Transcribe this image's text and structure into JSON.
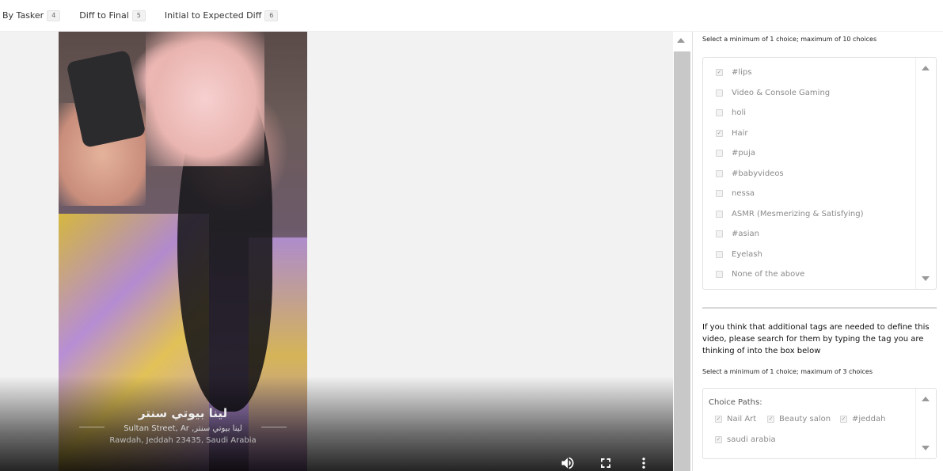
{
  "tabs": [
    {
      "label": "By Tasker",
      "count": "4"
    },
    {
      "label": "Diff to Final",
      "count": "5"
    },
    {
      "label": "Initial to Expected Diff",
      "count": "6"
    }
  ],
  "video": {
    "location_arabic": "لينا بيوتي سنتر",
    "location_street": "Sultan Street, Ar ,لينا بيوتي سنتر",
    "location_city": "Rawdah, Jeddah 23435, Saudi Arabia",
    "controls": {
      "volume_icon": "volume-icon",
      "fullscreen_icon": "fullscreen-icon",
      "more_icon": "more-vertical-icon"
    }
  },
  "panel": {
    "choices_hint": "Select a minimum of 1 choice; maximum of 10 choices",
    "choices": [
      {
        "label": "#lips",
        "checked": true
      },
      {
        "label": "Video & Console Gaming",
        "checked": false
      },
      {
        "label": "holi",
        "checked": false
      },
      {
        "label": "Hair",
        "checked": true
      },
      {
        "label": "#puja",
        "checked": false
      },
      {
        "label": "#babyvideos",
        "checked": false
      },
      {
        "label": "nessa",
        "checked": false
      },
      {
        "label": "ASMR (Mesmerizing & Satisfying)",
        "checked": false
      },
      {
        "label": "#asian",
        "checked": false
      },
      {
        "label": "Eyelash",
        "checked": false
      },
      {
        "label": "None of the above",
        "checked": false
      }
    ],
    "additional_prompt": "If you think that additional tags are needed to define this video, please search for them by typing the tag you are thinking of into the box below",
    "paths_hint": "Select a minimum of 1 choice; maximum of 3 choices",
    "paths_title": "Choice Paths:",
    "paths": [
      {
        "label": "Nail Art",
        "checked": true
      },
      {
        "label": "Beauty salon",
        "checked": true
      },
      {
        "label": "#jeddah",
        "checked": true
      },
      {
        "label": "saudi arabia",
        "checked": true
      }
    ]
  }
}
